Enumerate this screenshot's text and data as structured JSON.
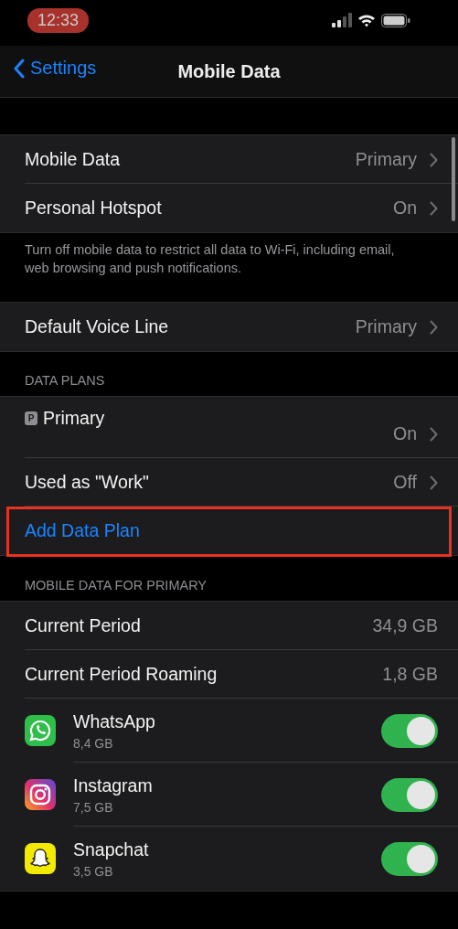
{
  "status_bar": {
    "time": "12:33"
  },
  "nav": {
    "back": "Settings",
    "title": "Mobile Data"
  },
  "groups": [
    {
      "rows": [
        {
          "kind": "value",
          "label": "Mobile Data",
          "value": "Primary"
        },
        {
          "kind": "value",
          "label": "Personal Hotspot",
          "value": "On"
        }
      ],
      "footer": "Turn off mobile data to restrict all data to Wi-Fi, including email, web browsing and push notifications."
    },
    {
      "rows": [
        {
          "kind": "value",
          "label": "Default Voice Line",
          "value": "Primary"
        }
      ]
    },
    {
      "header": "DATA PLANS",
      "rows": [
        {
          "kind": "plan",
          "badge": "P",
          "label": "Primary",
          "value": "On"
        },
        {
          "kind": "value",
          "label": "Used as \"Work\"",
          "value": "Off"
        },
        {
          "kind": "link",
          "label": "Add Data Plan",
          "highlighted": true
        }
      ]
    },
    {
      "header": "MOBILE DATA FOR PRIMARY",
      "rows": [
        {
          "kind": "stat",
          "label": "Current Period",
          "value": "34,9 GB"
        },
        {
          "kind": "stat",
          "label": "Current Period Roaming",
          "value": "1,8 GB"
        },
        {
          "kind": "app",
          "label": "WhatsApp",
          "sub": "8,4 GB",
          "on": true
        },
        {
          "kind": "app",
          "label": "Instagram",
          "sub": "7,5 GB",
          "on": true
        },
        {
          "kind": "app",
          "label": "Snapchat",
          "sub": "3,5 GB",
          "on": true
        }
      ]
    }
  ]
}
